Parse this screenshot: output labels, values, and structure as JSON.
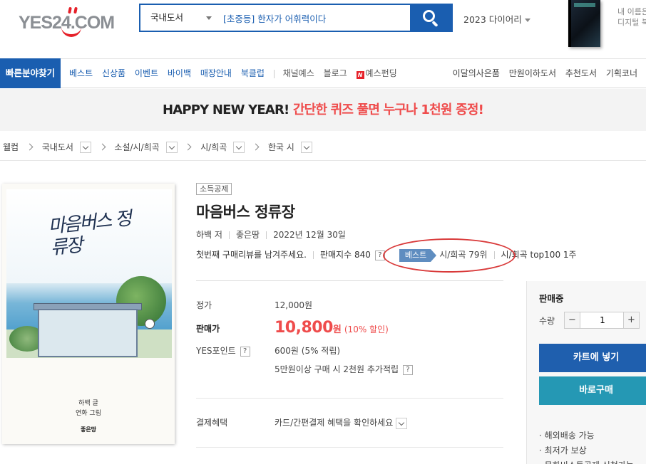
{
  "header": {
    "logo_text": "YES24.COM",
    "search": {
      "category": "국내도서",
      "query": "[초중등] 한자가 어휘력이다"
    },
    "diary_link": "2023 다이어리",
    "ad_text": [
      "내 이름은",
      "디지털 북"
    ]
  },
  "nav": {
    "quick_menu": "빠른분야찾기",
    "main_items": [
      "베스트",
      "신상품",
      "이벤트",
      "바이백",
      "매장안내",
      "북클럽"
    ],
    "sub_items": [
      "채널예스",
      "블로그"
    ],
    "yes_funding_badge": "N",
    "yes_funding": "예스펀딩",
    "right_items": [
      "이달의사은품",
      "만원이하도서",
      "추천도서",
      "기획코너"
    ]
  },
  "promo": {
    "black_text": "HAPPY NEW YEAR!",
    "red_text": "간단한 퀴즈 풀면 누구나 1천원 증정!"
  },
  "breadcrumb": [
    "웰컴",
    "국내도서",
    "소설/시/희곡",
    "시/희곡",
    "한국 시"
  ],
  "cover": {
    "title": "마음버스 정류장",
    "author_line": "하백 글",
    "illustrator_line": "연화 그림",
    "publisher": "좋은땅"
  },
  "product": {
    "tag": "소득공제",
    "title": "마음버스 정류장",
    "author": "하백 저",
    "publisher": "좋은땅",
    "date": "2022년 12월 30일",
    "review_prompt": "첫번째 구매리뷰를 남겨주세요.",
    "sales_index": "판매지수 840",
    "help_mark": "?",
    "best_tag": "베스트",
    "best_rank": "시/희곡 79위",
    "top100": "시/희곡 top100 1주"
  },
  "price": {
    "list_label": "정가",
    "list_price": "12,000원",
    "sale_label": "판매가",
    "sale_price": "10,800",
    "sale_unit": "원",
    "discount": "(10% 할인)",
    "points_label": "YES포인트",
    "points_value": "600원 (5% 적립)",
    "extra_points": "5만원이상 구매 시 2천원 추가적립",
    "payment_label": "결제혜택",
    "payment_value": "카드/간편결제 혜택을 확인하세요"
  },
  "purchase": {
    "status": "판매중",
    "qty_label": "수량",
    "minus": "−",
    "plus": "+",
    "qty": "1",
    "cart_button": "카트에 넣기",
    "buy_button": "바로구매",
    "notes": [
      "· 해외배송 가능",
      "· 최저가 보상",
      "· 문화비소득공제 신청가능"
    ]
  }
}
